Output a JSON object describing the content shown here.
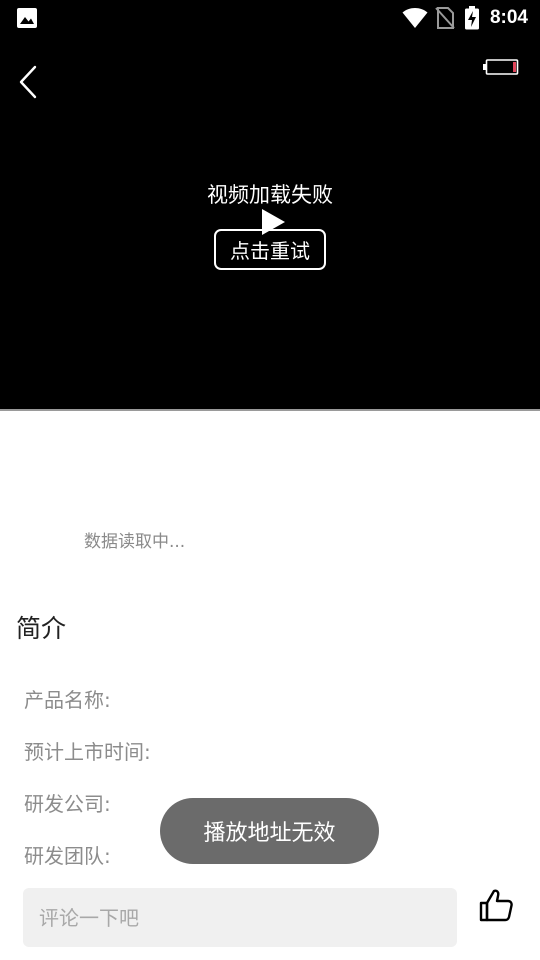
{
  "status_bar": {
    "time": "8:04",
    "icons": [
      "image-notification-icon",
      "wifi-icon",
      "no-sim-icon",
      "battery-charging-icon"
    ]
  },
  "player": {
    "error_message": "视频加载失败",
    "retry_label": "点击重试",
    "icons": [
      "back-arrow-icon",
      "battery-low-icon",
      "play-icon"
    ]
  },
  "content": {
    "loading_text": "数据读取中...",
    "section_title": "简介",
    "fields": [
      {
        "label": "产品名称:"
      },
      {
        "label": "预计上市时间:"
      },
      {
        "label": "研发公司:"
      },
      {
        "label": "研发团队:"
      }
    ]
  },
  "toast": {
    "message": "播放地址无效"
  },
  "comment_bar": {
    "placeholder": "评论一下吧",
    "value": "",
    "like_icon": "thumbs-up-icon"
  },
  "colors": {
    "player_background": "#000000",
    "toast_background": "#6b6b6b",
    "input_background": "#f0f0f0",
    "label_gray": "#8c8c8c",
    "battery_low_red": "#e0455a"
  }
}
